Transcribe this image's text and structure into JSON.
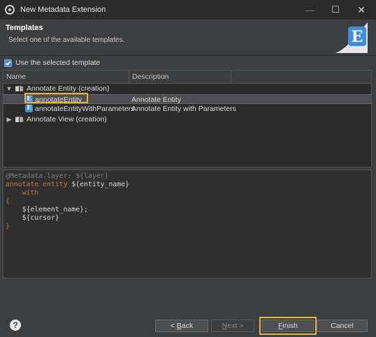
{
  "window": {
    "title": "New Metadata Extension",
    "minimize_glyph": "—",
    "maximize_glyph": "☐",
    "close_glyph": "✕"
  },
  "banner": {
    "heading": "Templates",
    "subtitle": "Select one of the available templates.",
    "logo_letter": "E"
  },
  "use_template": {
    "label": "Use the selected template",
    "checked": true
  },
  "table": {
    "columns": [
      "Name",
      "Description"
    ],
    "rows": [
      {
        "level": 0,
        "expanded": true,
        "icon": "book-icon",
        "name": "Annotate Entity (creation)",
        "description": ""
      },
      {
        "level": 1,
        "icon": "template-e-icon",
        "name": "annotateEntity",
        "description": "Annotate Entity",
        "selected": true
      },
      {
        "level": 1,
        "icon": "template-e-icon",
        "name": "annotateEntityWithParameters",
        "description": "Annotate Entity with Parameters"
      },
      {
        "level": 0,
        "expanded": false,
        "icon": "book-icon",
        "name": "Annotate View (creation)",
        "description": ""
      }
    ]
  },
  "editor": {
    "lines": [
      [
        {
          "t": "ann",
          "v": "@Metadata.layer: ${layer}"
        }
      ],
      [
        {
          "t": "kw",
          "v": "annotate entity"
        },
        {
          "t": "txt",
          "v": " ${entity_name}"
        }
      ],
      [
        {
          "t": "kw",
          "v": "    with"
        }
      ],
      [
        {
          "t": "kw",
          "v": "{"
        }
      ],
      [
        {
          "t": "txt",
          "v": "    ${element_name};"
        }
      ],
      [
        {
          "t": "txt",
          "v": "    ${cursor}"
        }
      ],
      [
        {
          "t": "kw",
          "v": "}"
        }
      ]
    ]
  },
  "footer": {
    "help_glyph": "?",
    "back_prefix": "< ",
    "back_mnemonic": "B",
    "back_rest": "ack",
    "next_mnemonic": "N",
    "next_rest": "ext >",
    "finish_mnemonic": "F",
    "finish_rest": "inish",
    "cancel_label": "Cancel"
  },
  "colors": {
    "highlight": "#f0b23a",
    "keyword": "#cc7832",
    "annotation": "#7f7f7f",
    "accent": "#3e8ede"
  }
}
